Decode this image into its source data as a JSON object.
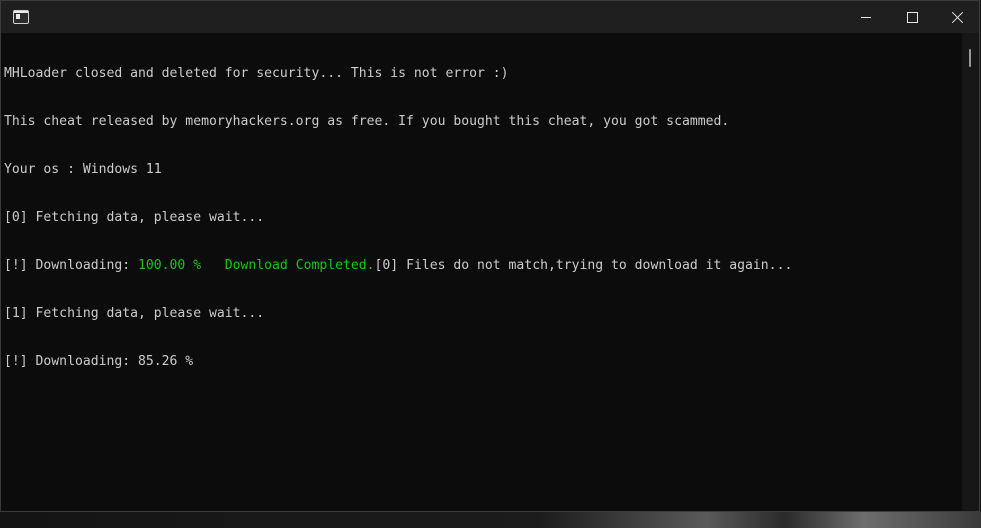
{
  "window": {
    "controls": {
      "minimize": "minimize",
      "maximize": "maximize",
      "close": "close"
    }
  },
  "console": {
    "lines": [
      "MHLoader closed and deleted for security... This is not error :)",
      "This cheat released by memoryhackers.org as free. If you bought this cheat, you got scammed.",
      "Your os : Windows 11",
      "[0] Fetching data, please wait...",
      {
        "prefix": "[!] Downloading: ",
        "percent": "100.00 %",
        "spacer": "   ",
        "completed": "Download Completed.",
        "rest": "[0] Files do not match,trying to download it again..."
      },
      "[1] Fetching data, please wait...",
      "[!] Downloading: 85.26 %"
    ],
    "colors": {
      "text": "#cccccc",
      "highlight": "#16c60c",
      "background": "#0c0c0c"
    }
  }
}
